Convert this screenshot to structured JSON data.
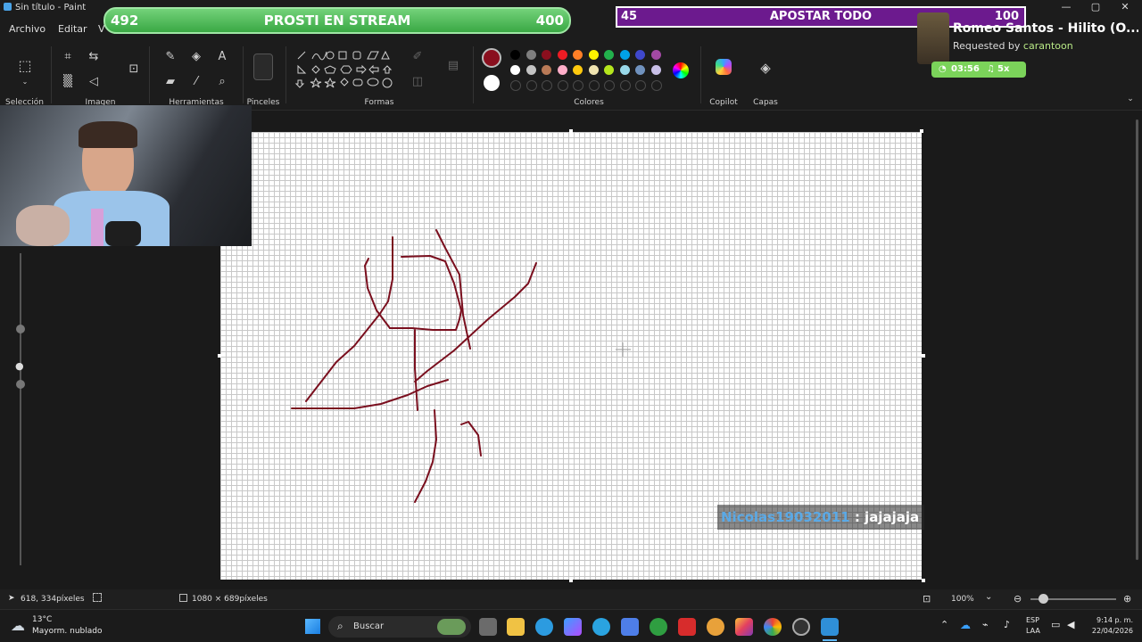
{
  "window": {
    "title": "Sin título - Paint",
    "controls": [
      "—",
      "▢",
      "✕"
    ]
  },
  "menu": {
    "file": "Archivo",
    "edit": "Editar",
    "view": "V"
  },
  "ribbon": {
    "groups": {
      "selection": "Selección",
      "image": "Imagen",
      "tools": "Herramientas",
      "brushes": "Pinceles",
      "shapes": "Formas",
      "colors": "Colores",
      "copilot": "Copilot",
      "layers": "Capas"
    },
    "primary_color": "#8a0f1e",
    "secondary_color": "#ffffff",
    "palette_row1": [
      "#000000",
      "#7f7f7f",
      "#8a0f1e",
      "#ed1c24",
      "#ff7f27",
      "#fff200",
      "#22b14c",
      "#00a2e8",
      "#3f48cc",
      "#a349a4"
    ],
    "palette_row2": [
      "#ffffff",
      "#c3c3c3",
      "#b97a57",
      "#ffaec9",
      "#ffc90e",
      "#efe4b0",
      "#b5e61d",
      "#99d9ea",
      "#7092be",
      "#c8bfe7"
    ]
  },
  "overlay": {
    "bar1_left": "492",
    "bar1_title": "PROSTI EN STREAM",
    "bar1_right": "400",
    "bar2_left": "45",
    "bar2_title": "APOSTAR TODO",
    "bar2_right": "100",
    "song_title": "Romeo Santos - Hilito (O...",
    "requested_prefix": "Requested by ",
    "requested_user": "carantoon",
    "timer": "03:56",
    "multiplier": "5x",
    "chat_user": "Nicolas19032011",
    "chat_sep": " : ",
    "chat_msg": "jajajaja"
  },
  "status": {
    "cursor_pos": "618, 334píxeles",
    "canvas_size": "1080 × 689píxeles",
    "zoom": "100%"
  },
  "taskbar": {
    "weather_temp": "13°C",
    "weather_desc": "Mayorm. nublado",
    "search_placeholder": "Buscar",
    "lang_top": "ESP",
    "lang_bottom": "LAA",
    "time": "9:14 p. m.",
    "date": "22/04/2026"
  }
}
